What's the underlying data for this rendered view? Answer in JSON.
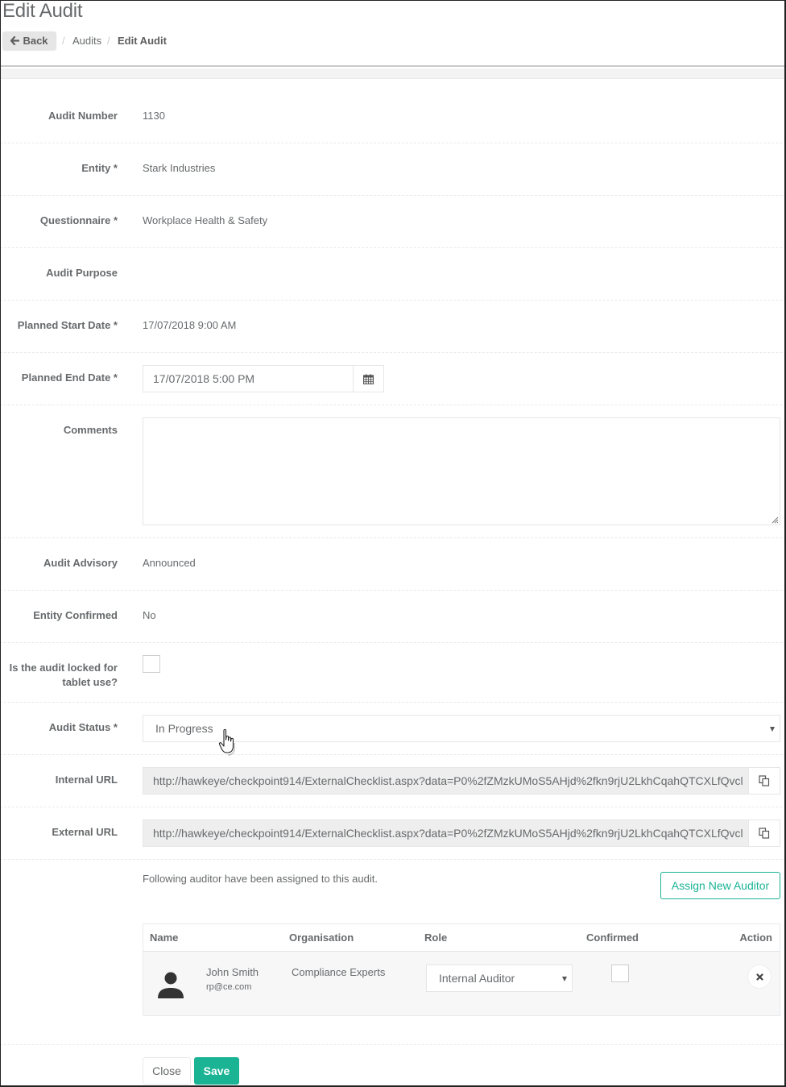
{
  "header": {
    "title": "Edit Audit",
    "back_label": "Back",
    "breadcrumb": [
      "Audits",
      "Edit Audit"
    ],
    "breadcrumb_separator": "/"
  },
  "form": {
    "audit_number": {
      "label": "Audit Number",
      "value": "1130"
    },
    "entity": {
      "label": "Entity *",
      "value": "Stark Industries"
    },
    "questionnaire": {
      "label": "Questionnaire *",
      "value": "Workplace Health & Safety"
    },
    "audit_purpose": {
      "label": "Audit Purpose",
      "value": ""
    },
    "planned_start_date": {
      "label": "Planned Start Date *",
      "value": "17/07/2018 9:00 AM"
    },
    "planned_end_date": {
      "label": "Planned End Date *",
      "value": "17/07/2018 5:00 PM",
      "icon": "calendar-icon"
    },
    "comments": {
      "label": "Comments",
      "value": ""
    },
    "audit_advisory": {
      "label": "Audit Advisory",
      "value": "Announced"
    },
    "entity_confirmed": {
      "label": "Entity Confirmed",
      "value": "No"
    },
    "locked_for_tablet": {
      "label_line1": "Is the audit locked for",
      "label_line2": "tablet use?",
      "checked": false
    },
    "audit_status": {
      "label": "Audit Status *",
      "value": "In Progress"
    },
    "internal_url": {
      "label": "Internal URL",
      "value": "http://hawkeye/checkpoint914/ExternalChecklist.aspx?data=P0%2fZMzkUMoS5AHjd%2fkn9rjU2LkhCqahQTCXLfQvcl",
      "icon": "copy-icon"
    },
    "external_url": {
      "label": "External URL",
      "value": "http://hawkeye/checkpoint914/ExternalChecklist.aspx?data=P0%2fZMzkUMoS5AHjd%2fkn9rjU2LkhCqahQTCXLfQvcl",
      "icon": "copy-icon"
    }
  },
  "auditors": {
    "intro": "Following auditor have been assigned to this audit.",
    "assign_button": "Assign New Auditor",
    "columns": [
      "Name",
      "Organisation",
      "Role",
      "Confirmed",
      "Action"
    ],
    "rows": [
      {
        "name": "John Smith",
        "email": "rp@ce.com",
        "organisation": "Compliance Experts",
        "role": "Internal Auditor",
        "confirmed": false,
        "action_icon": "remove-icon"
      }
    ]
  },
  "footer": {
    "close_label": "Close",
    "save_label": "Save"
  },
  "colors": {
    "accent": "#1ab394",
    "text": "#676a6c",
    "readonly_bg": "#eeeeee"
  }
}
